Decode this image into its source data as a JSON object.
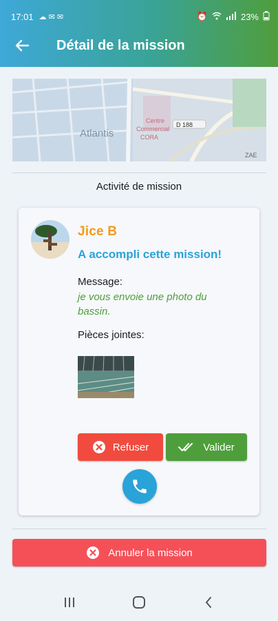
{
  "status_bar": {
    "time": "17:01",
    "battery": "23%"
  },
  "header": {
    "title": "Détail de la mission"
  },
  "map": {
    "labels": [
      "Atlantis",
      "Centre",
      "Commercial",
      "CORA",
      "D 188",
      "ZAE"
    ]
  },
  "activity": {
    "title": "Activité de mission"
  },
  "card": {
    "user_name": "Jice B",
    "status_text": "A accompli cette mission!",
    "message_label": "Message:",
    "message_text": "je vous envoie une photo du bassin.",
    "attachments_label": "Pièces jointes:",
    "refuse_label": "Refuser",
    "validate_label": "Valider"
  },
  "footer": {
    "cancel_label": "Annuler la mission"
  },
  "colors": {
    "accent_blue": "#2aa3d9",
    "accent_green": "#4f9e3c",
    "name_orange": "#f39a1e",
    "refuse_red": "#f14b3f",
    "cancel_red": "#f55058"
  },
  "icons": [
    "back-arrow-icon",
    "close-circle-icon",
    "double-check-icon",
    "phone-icon",
    "recent-apps-icon",
    "home-icon",
    "back-nav-icon"
  ]
}
